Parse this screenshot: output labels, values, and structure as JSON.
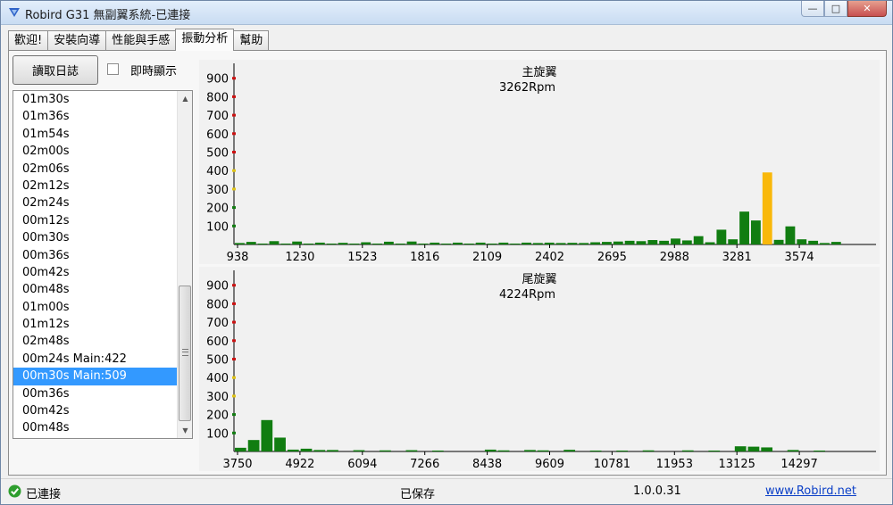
{
  "window": {
    "title": "Robird G31 無副翼系統-已連接",
    "controls": {
      "minimize": "—",
      "maximize": "□",
      "close": "✕"
    }
  },
  "tabs": [
    {
      "label": "歡迎!"
    },
    {
      "label": "安裝向導"
    },
    {
      "label": "性能與手感"
    },
    {
      "label": "振動分析",
      "active": true
    },
    {
      "label": "幫助"
    }
  ],
  "toolbar": {
    "read_log_label": "讀取日誌",
    "realtime_label": "即時顯示",
    "realtime_checked": false
  },
  "log_list": {
    "items": [
      "01m30s",
      "01m36s",
      "01m54s",
      "02m00s",
      "02m06s",
      "02m12s",
      "02m24s",
      "00m12s",
      "00m30s",
      "00m36s",
      "00m42s",
      "00m48s",
      "01m00s",
      "01m12s",
      "02m48s",
      "00m24s Main:422",
      "00m30s Main:509",
      "00m36s",
      "00m42s",
      "00m48s"
    ],
    "selected_index": 16
  },
  "chart_data": [
    {
      "type": "bar",
      "title": "主旋翼",
      "subtitle": "3262Rpm",
      "ylim": [
        0,
        1000
      ],
      "yticks": [
        100,
        200,
        300,
        400,
        500,
        600,
        700,
        800,
        900
      ],
      "xticks": [
        "938",
        "1230",
        "1523",
        "1816",
        "2109",
        "2402",
        "2695",
        "2988",
        "3281",
        "3574"
      ],
      "x_range": [
        938,
        3681
      ],
      "bin_width": 49,
      "bars": [
        {
          "x": 938,
          "v": 8
        },
        {
          "x": 987,
          "v": 14
        },
        {
          "x": 1036,
          "v": 5
        },
        {
          "x": 1085,
          "v": 18
        },
        {
          "x": 1134,
          "v": 5
        },
        {
          "x": 1183,
          "v": 16
        },
        {
          "x": 1232,
          "v": 5
        },
        {
          "x": 1281,
          "v": 10
        },
        {
          "x": 1330,
          "v": 5
        },
        {
          "x": 1379,
          "v": 9
        },
        {
          "x": 1428,
          "v": 5
        },
        {
          "x": 1477,
          "v": 12
        },
        {
          "x": 1526,
          "v": 5
        },
        {
          "x": 1575,
          "v": 15
        },
        {
          "x": 1624,
          "v": 5
        },
        {
          "x": 1673,
          "v": 16
        },
        {
          "x": 1722,
          "v": 5
        },
        {
          "x": 1771,
          "v": 10
        },
        {
          "x": 1820,
          "v": 5
        },
        {
          "x": 1869,
          "v": 10
        },
        {
          "x": 1918,
          "v": 5
        },
        {
          "x": 1967,
          "v": 10
        },
        {
          "x": 2016,
          "v": 5
        },
        {
          "x": 2065,
          "v": 10
        },
        {
          "x": 2114,
          "v": 5
        },
        {
          "x": 2163,
          "v": 10
        },
        {
          "x": 2212,
          "v": 8
        },
        {
          "x": 2261,
          "v": 10
        },
        {
          "x": 2310,
          "v": 8
        },
        {
          "x": 2359,
          "v": 9
        },
        {
          "x": 2408,
          "v": 8
        },
        {
          "x": 2457,
          "v": 12
        },
        {
          "x": 2506,
          "v": 14
        },
        {
          "x": 2555,
          "v": 16
        },
        {
          "x": 2604,
          "v": 20
        },
        {
          "x": 2653,
          "v": 18
        },
        {
          "x": 2702,
          "v": 24
        },
        {
          "x": 2751,
          "v": 20
        },
        {
          "x": 2800,
          "v": 32
        },
        {
          "x": 2849,
          "v": 22
        },
        {
          "x": 2898,
          "v": 45
        },
        {
          "x": 2947,
          "v": 12
        },
        {
          "x": 2996,
          "v": 80
        },
        {
          "x": 3045,
          "v": 28
        },
        {
          "x": 3094,
          "v": 178
        },
        {
          "x": 3143,
          "v": 130
        },
        {
          "x": 3192,
          "v": 390,
          "peak": true
        },
        {
          "x": 3241,
          "v": 25
        },
        {
          "x": 3290,
          "v": 98
        },
        {
          "x": 3339,
          "v": 28
        },
        {
          "x": 3388,
          "v": 20
        },
        {
          "x": 3437,
          "v": 8
        },
        {
          "x": 3486,
          "v": 14
        }
      ]
    },
    {
      "type": "bar",
      "title": "尾旋翼",
      "subtitle": "4224Rpm",
      "ylim": [
        0,
        1000
      ],
      "yticks": [
        100,
        200,
        300,
        400,
        500,
        600,
        700,
        800,
        900
      ],
      "xticks": [
        "3750",
        "4922",
        "6094",
        "7266",
        "8438",
        "9609",
        "10781",
        "11953",
        "13125",
        "14297"
      ],
      "x_range": [
        3750,
        15463
      ],
      "bin_width": 240,
      "bars": [
        {
          "x": 3750,
          "v": 20
        },
        {
          "x": 3990,
          "v": 62
        },
        {
          "x": 4230,
          "v": 170
        },
        {
          "x": 4470,
          "v": 75
        },
        {
          "x": 4710,
          "v": 10
        },
        {
          "x": 4950,
          "v": 15
        },
        {
          "x": 5190,
          "v": 8
        },
        {
          "x": 5430,
          "v": 8
        },
        {
          "x": 5910,
          "v": 7
        },
        {
          "x": 6390,
          "v": 6
        },
        {
          "x": 6870,
          "v": 7
        },
        {
          "x": 7350,
          "v": 5
        },
        {
          "x": 8310,
          "v": 10
        },
        {
          "x": 8550,
          "v": 6
        },
        {
          "x": 9030,
          "v": 8
        },
        {
          "x": 9270,
          "v": 6
        },
        {
          "x": 9750,
          "v": 9
        },
        {
          "x": 10230,
          "v": 5
        },
        {
          "x": 10710,
          "v": 5
        },
        {
          "x": 11190,
          "v": 6
        },
        {
          "x": 11910,
          "v": 6
        },
        {
          "x": 12390,
          "v": 5
        },
        {
          "x": 12870,
          "v": 28
        },
        {
          "x": 13110,
          "v": 26
        },
        {
          "x": 13350,
          "v": 22
        },
        {
          "x": 13830,
          "v": 8
        },
        {
          "x": 14310,
          "v": 5
        }
      ]
    }
  ],
  "statusbar": {
    "connection": "已連接",
    "saved": "已保存",
    "version": "1.0.0.31",
    "link": "www.Robird.net"
  },
  "colors": {
    "bar": "#117d11",
    "peak_bar": "#f9b80a",
    "tick_red": "#cc1111",
    "tick_yellow": "#e1c516",
    "tick_green": "#117d11",
    "selection": "#3399ff"
  }
}
